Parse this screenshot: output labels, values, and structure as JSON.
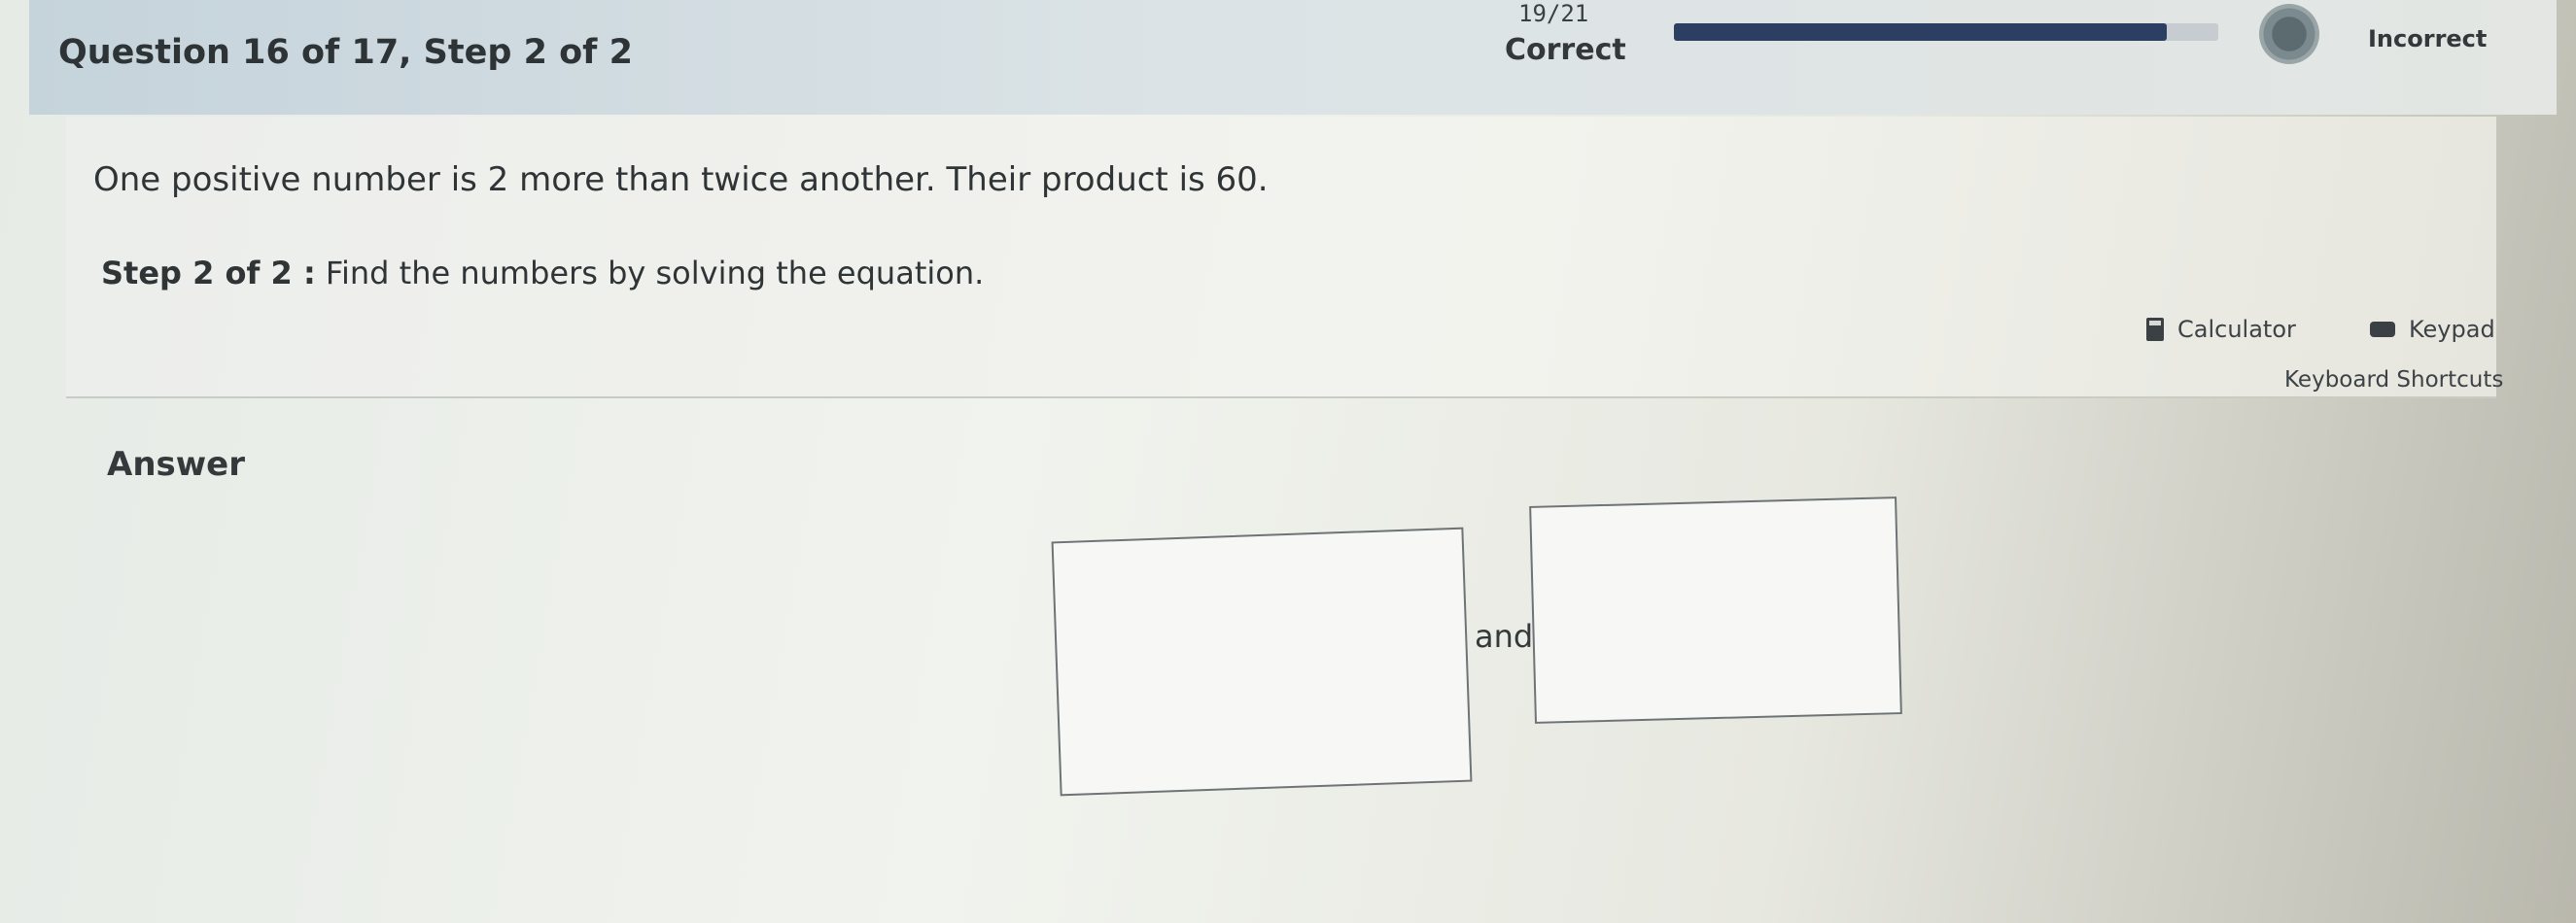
{
  "header": {
    "question_title": "Question 16 of 17,  Step 2 of 2",
    "count": "19/21",
    "correct_label": "Correct",
    "progress_fraction": 0.905,
    "incorrect_label": "Incorrect"
  },
  "question": {
    "problem": "One positive number is 2 more than twice another. Their product is 60.",
    "step_label": "Step 2 of 2 :",
    "step_text": "Find the numbers by solving the equation."
  },
  "tools": {
    "calculator": "Calculator",
    "keypad": "Keypad",
    "shortcuts": "Keyboard Shortcuts"
  },
  "answer": {
    "label": "Answer",
    "joiner": "and",
    "first_value": "",
    "second_value": ""
  }
}
